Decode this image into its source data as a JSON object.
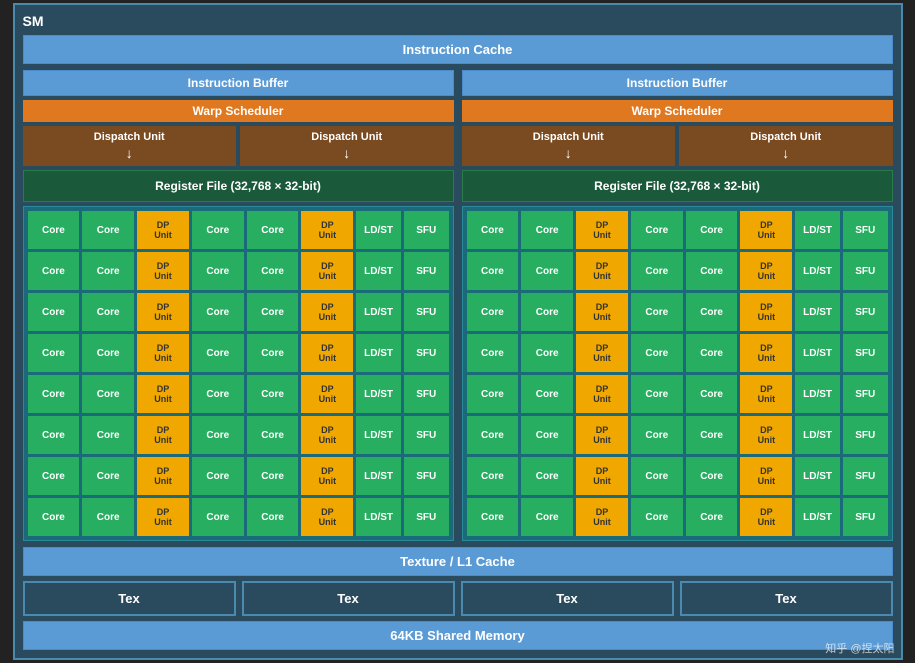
{
  "title": "SM",
  "instruction_cache": "Instruction Cache",
  "left_half": {
    "instruction_buffer": "Instruction Buffer",
    "warp_scheduler": "Warp Scheduler",
    "dispatch_units": [
      "Dispatch Unit",
      "Dispatch Unit"
    ],
    "register_file": "Register File (32,768 × 32-bit)"
  },
  "right_half": {
    "instruction_buffer": "Instruction Buffer",
    "warp_scheduler": "Warp Scheduler",
    "dispatch_units": [
      "Dispatch Unit",
      "Dispatch Unit"
    ],
    "register_file": "Register File (32,768 × 32-bit)"
  },
  "core_rows": 8,
  "row_pattern": [
    "Core",
    "Core",
    "DP\nUnit",
    "Core",
    "Core",
    "DP\nUnit",
    "LD/ST",
    "SFU"
  ],
  "texture_cache": "Texture / L1 Cache",
  "tex_units": [
    "Tex",
    "Tex",
    "Tex",
    "Tex"
  ],
  "shared_memory": "64KB Shared Memory",
  "watermark": "知乎 @捏太阳",
  "colors": {
    "core": "#27ae60",
    "dp_unit": "#f0a800",
    "ldst": "#27ae60",
    "sfu": "#27ae60",
    "instruction_buffer": "#5b9bd5",
    "warp_scheduler": "#e07820",
    "dispatch_unit": "#7a4a20",
    "register_file": "#1a5a3a",
    "texture_cache": "#5b9bd5",
    "shared_memory": "#5b9bd5"
  }
}
